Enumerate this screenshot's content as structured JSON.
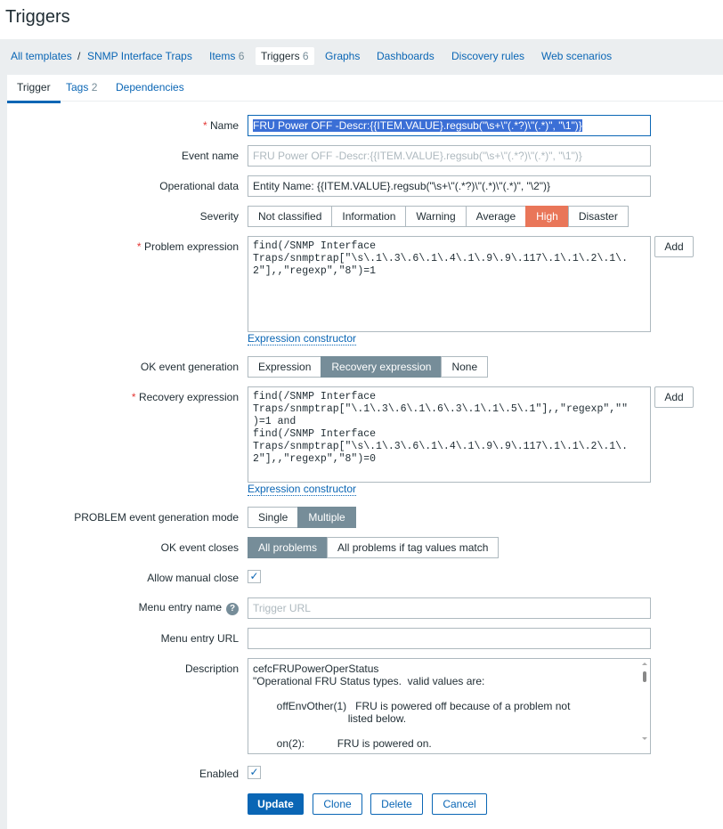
{
  "title": "Triggers",
  "nav": {
    "all_templates": "All templates",
    "separator": "/",
    "template": "SNMP Interface Traps",
    "items": "Items",
    "items_count": "6",
    "triggers": "Triggers",
    "triggers_count": "6",
    "graphs": "Graphs",
    "dashboards": "Dashboards",
    "discovery": "Discovery rules",
    "web": "Web scenarios"
  },
  "tabs": {
    "trigger": "Trigger",
    "tags": "Tags",
    "tags_count": "2",
    "dependencies": "Dependencies"
  },
  "form": {
    "name_label": "Name",
    "name_value": "FRU Power OFF -Descr:{{ITEM.VALUE}.regsub(\"\\s+\\\"(.*?)\\\"(.*)\", \"\\1\")}",
    "event_name_label": "Event name",
    "event_name_placeholder": "FRU Power OFF -Descr:{{ITEM.VALUE}.regsub(\"\\s+\\\"(.*?)\\\"(.*)\", \"\\1\")}",
    "opdata_label": "Operational data",
    "opdata_value": "Entity Name: {{ITEM.VALUE}.regsub(\"\\s+\\\"(.*?)\\\"(.*)\\\"(.*)\", \"\\2\")}",
    "severity_label": "Severity",
    "severity": [
      "Not classified",
      "Information",
      "Warning",
      "Average",
      "High",
      "Disaster"
    ],
    "problem_label": "Problem expression",
    "problem_value": "find(/SNMP Interface\nTraps/snmptrap[\"\\s\\.1\\.3\\.6\\.1\\.4\\.1\\.9\\.9\\.117\\.1\\.1\\.2\\.1\\.\n2\"],,\"regexp\",\"8\")=1",
    "add": "Add",
    "constructor": "Expression constructor",
    "ok_gen_label": "OK event generation",
    "ok_gen": [
      "Expression",
      "Recovery expression",
      "None"
    ],
    "recovery_label": "Recovery expression",
    "recovery_value": "find(/SNMP Interface\nTraps/snmptrap[\"\\.1\\.3\\.6\\.1\\.6\\.3\\.1\\.1\\.5\\.1\"],,\"regexp\",\"\"\n)=1 and\nfind(/SNMP Interface\nTraps/snmptrap[\"\\s\\.1\\.3\\.6\\.1\\.4\\.1\\.9\\.9\\.117\\.1\\.1\\.2\\.1\\.\n2\"],,\"regexp\",\"8\")=0",
    "mode_label": "PROBLEM event generation mode",
    "mode": [
      "Single",
      "Multiple"
    ],
    "closes_label": "OK event closes",
    "closes": [
      "All problems",
      "All problems if tag values match"
    ],
    "manual_label": "Allow manual close",
    "menu_name_label": "Menu entry name",
    "menu_name_placeholder": "Trigger URL",
    "help": "?",
    "menu_url_label": "Menu entry URL",
    "desc_label": "Description",
    "desc_value": "cefcFRUPowerOperStatus\n\"Operational FRU Status types.  valid values are:\n\n        offEnvOther(1)   FRU is powered off because of a problem not\n                                listed below.\n\n        on(2):           FRU is powered on.",
    "enabled_label": "Enabled",
    "check": "✓",
    "update": "Update",
    "clone": "Clone",
    "delete": "Delete",
    "cancel": "Cancel"
  }
}
